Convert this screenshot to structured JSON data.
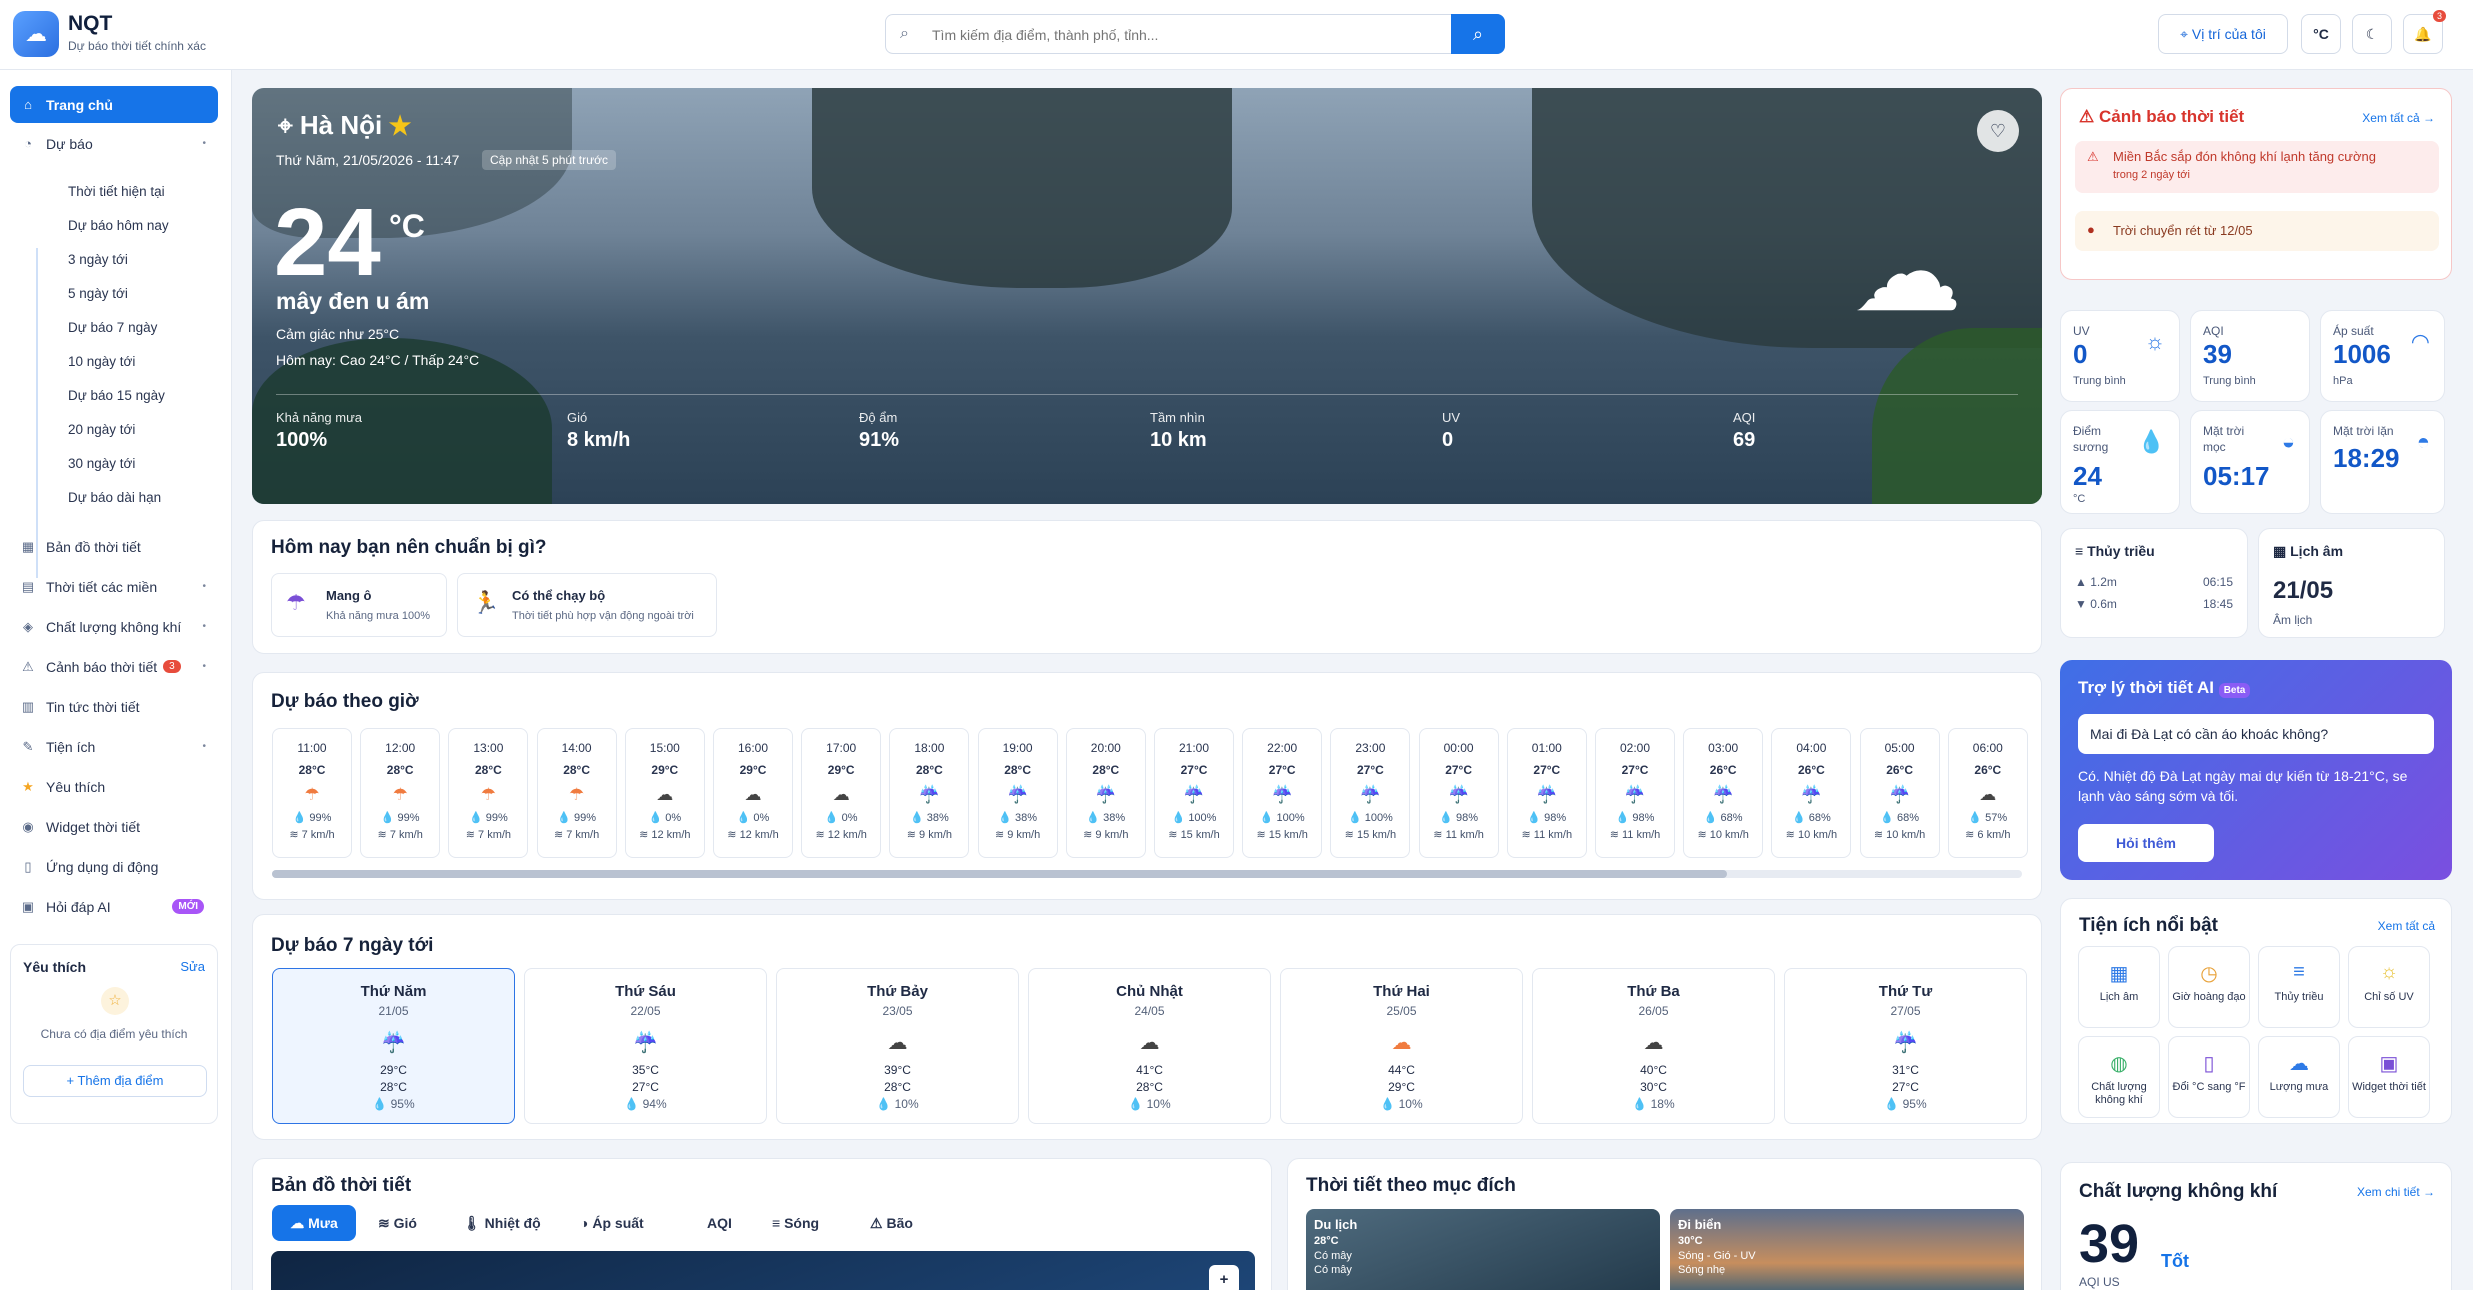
{
  "header": {
    "brand": "NQT",
    "tagline": "Dự báo thời tiết chính xác",
    "search_placeholder": "Tìm kiếm địa điểm, thành phố, tỉnh...",
    "location_btn": "Vị trí của tôi",
    "unit_btn": "°C",
    "notif_count": "3"
  },
  "sidebar": {
    "items": [
      {
        "label": "Trang chủ",
        "icon": "home-icon"
      },
      {
        "label": "Dự báo",
        "icon": "forecast-icon"
      },
      {
        "label": "Bản đồ thời tiết",
        "icon": "map-icon"
      },
      {
        "label": "Thời tiết các miền",
        "icon": "region-icon"
      },
      {
        "label": "Chất lượng không khí",
        "icon": "air-icon"
      },
      {
        "label": "Cảnh báo thời tiết",
        "icon": "alert-icon",
        "badge": "3"
      },
      {
        "label": "Tin tức thời tiết",
        "icon": "news-icon"
      },
      {
        "label": "Tiện ích",
        "icon": "tools-icon"
      },
      {
        "label": "Yêu thích",
        "icon": "star-icon"
      },
      {
        "label": "Widget thời tiết",
        "icon": "widget-icon"
      },
      {
        "label": "Ứng dụng di động",
        "icon": "phone-icon"
      },
      {
        "label": "Hỏi đáp AI",
        "icon": "ai-icon",
        "badge": "MỚI"
      }
    ],
    "sub": [
      "Thời tiết hiện tại",
      "Dự báo hôm nay",
      "3 ngày tới",
      "5 ngày tới",
      "Dự báo 7 ngày",
      "10 ngày tới",
      "Dự báo 15 ngày",
      "20 ngày tới",
      "30 ngày tới",
      "Dự báo dài hạn"
    ],
    "fav": {
      "title": "Yêu thích",
      "edit": "Sửa",
      "empty": "Chưa có địa điểm yêu thích",
      "add": "+ Thêm địa điểm"
    }
  },
  "hero": {
    "city": "Hà Nội",
    "datetime": "Thứ Năm, 21/05/2026 - 11:47",
    "updated": "Cập nhật 5 phút trước",
    "temp": "24",
    "unit": "°C",
    "desc": "mây đen u ám",
    "feels": "Cảm giác như 25°C",
    "today": "Hôm nay: Cao 24°C / Thấp 24°C",
    "stats": [
      {
        "label": "Khả năng mưa",
        "value": "100%"
      },
      {
        "label": "Gió",
        "value": "8 km/h"
      },
      {
        "label": "Độ ẩm",
        "value": "91%"
      },
      {
        "label": "Tầm nhìn",
        "value": "10 km"
      },
      {
        "label": "UV",
        "value": "0"
      },
      {
        "label": "AQI",
        "value": "69"
      }
    ]
  },
  "prep": {
    "title": "Hôm nay bạn nên chuẩn bị gì?",
    "items": [
      {
        "title": "Mang ô",
        "sub": "Khả năng mưa 100%"
      },
      {
        "title": "Có thể chạy bộ",
        "sub": "Thời tiết phù hợp vận động ngoài trời"
      }
    ]
  },
  "hourly": {
    "title": "Dự báo theo giờ",
    "items": [
      {
        "t": "11:00",
        "tp": "28°C",
        "r": "99%",
        "w": "7 km/h",
        "i": "sun-rain"
      },
      {
        "t": "12:00",
        "tp": "28°C",
        "r": "99%",
        "w": "7 km/h",
        "i": "sun-rain"
      },
      {
        "t": "13:00",
        "tp": "28°C",
        "r": "99%",
        "w": "7 km/h",
        "i": "sun-rain"
      },
      {
        "t": "14:00",
        "tp": "28°C",
        "r": "99%",
        "w": "7 km/h",
        "i": "sun-rain"
      },
      {
        "t": "15:00",
        "tp": "29°C",
        "r": "0%",
        "w": "12 km/h",
        "i": "cloud"
      },
      {
        "t": "16:00",
        "tp": "29°C",
        "r": "0%",
        "w": "12 km/h",
        "i": "cloud"
      },
      {
        "t": "17:00",
        "tp": "29°C",
        "r": "0%",
        "w": "12 km/h",
        "i": "cloud"
      },
      {
        "t": "18:00",
        "tp": "28°C",
        "r": "38%",
        "w": "9 km/h",
        "i": "rain"
      },
      {
        "t": "19:00",
        "tp": "28°C",
        "r": "38%",
        "w": "9 km/h",
        "i": "rain"
      },
      {
        "t": "20:00",
        "tp": "28°C",
        "r": "38%",
        "w": "9 km/h",
        "i": "rain"
      },
      {
        "t": "21:00",
        "tp": "27°C",
        "r": "100%",
        "w": "15 km/h",
        "i": "rain"
      },
      {
        "t": "22:00",
        "tp": "27°C",
        "r": "100%",
        "w": "15 km/h",
        "i": "rain"
      },
      {
        "t": "23:00",
        "tp": "27°C",
        "r": "100%",
        "w": "15 km/h",
        "i": "rain"
      },
      {
        "t": "00:00",
        "tp": "27°C",
        "r": "98%",
        "w": "11 km/h",
        "i": "rain"
      },
      {
        "t": "01:00",
        "tp": "27°C",
        "r": "98%",
        "w": "11 km/h",
        "i": "rain"
      },
      {
        "t": "02:00",
        "tp": "27°C",
        "r": "98%",
        "w": "11 km/h",
        "i": "rain"
      },
      {
        "t": "03:00",
        "tp": "26°C",
        "r": "68%",
        "w": "10 km/h",
        "i": "rain"
      },
      {
        "t": "04:00",
        "tp": "26°C",
        "r": "68%",
        "w": "10 km/h",
        "i": "rain"
      },
      {
        "t": "05:00",
        "tp": "26°C",
        "r": "68%",
        "w": "10 km/h",
        "i": "rain"
      },
      {
        "t": "06:00",
        "tp": "26°C",
        "r": "57%",
        "w": "6 km/h",
        "i": "cloud"
      }
    ]
  },
  "daily": {
    "title": "Dự báo 7 ngày tới",
    "items": [
      {
        "d": "Thứ Năm",
        "dt": "21/05",
        "hi": "29°C",
        "lo": "28°C",
        "r": "95%",
        "i": "rain"
      },
      {
        "d": "Thứ Sáu",
        "dt": "22/05",
        "hi": "35°C",
        "lo": "27°C",
        "r": "94%",
        "i": "rain"
      },
      {
        "d": "Thứ Bảy",
        "dt": "23/05",
        "hi": "39°C",
        "lo": "28°C",
        "r": "10%",
        "i": "cloud"
      },
      {
        "d": "Chủ Nhật",
        "dt": "24/05",
        "hi": "41°C",
        "lo": "28°C",
        "r": "10%",
        "i": "cloud"
      },
      {
        "d": "Thứ Hai",
        "dt": "25/05",
        "hi": "44°C",
        "lo": "29°C",
        "r": "10%",
        "i": "sun-cloud"
      },
      {
        "d": "Thứ Ba",
        "dt": "26/05",
        "hi": "40°C",
        "lo": "30°C",
        "r": "18%",
        "i": "cloud"
      },
      {
        "d": "Thứ Tư",
        "dt": "27/05",
        "hi": "31°C",
        "lo": "27°C",
        "r": "95%",
        "i": "rain"
      }
    ]
  },
  "map": {
    "title": "Bản đồ thời tiết",
    "tabs": [
      "Mưa",
      "Gió",
      "Nhiệt độ",
      "Áp suất",
      "AQI",
      "Sóng",
      "Bão"
    ]
  },
  "purpose": {
    "title": "Thời tiết theo mục đích",
    "items": [
      {
        "name": "Du lịch",
        "temp": "28°C",
        "l1": "Có mây",
        "l2": "Có mây"
      },
      {
        "name": "Đi biển",
        "temp": "30°C",
        "l1": "Sóng - Gió - UV",
        "l2": "Sóng nhẹ"
      }
    ]
  },
  "alerts": {
    "title": "Cảnh báo thời tiết",
    "more": "Xem tất cả →",
    "items": [
      "Miền Bắc sắp đón không khí lạnh tăng cường",
      "Trời chuyển rét từ 12/05"
    ],
    "sub": "trong 2 ngày tới"
  },
  "metrics": [
    {
      "label": "UV",
      "value": "0",
      "sub": "Trung bình",
      "icon": "sun-icon"
    },
    {
      "label": "AQI",
      "value": "39",
      "sub": "Trung bình",
      "icon": "aqi-icon"
    },
    {
      "label": "Áp suất",
      "value": "1006",
      "sub": "hPa",
      "icon": "gauge-icon"
    },
    {
      "label": "Điểm sương",
      "value": "24",
      "sub": "°C",
      "icon": "drop-icon"
    },
    {
      "label": "Mặt trời mọc",
      "value": "05:17",
      "sub": "",
      "icon": "sunrise-icon"
    },
    {
      "label": "Mặt trời lặn",
      "value": "18:29",
      "sub": "",
      "icon": "sunset-icon"
    }
  ],
  "tide": {
    "title": "Thủy triều",
    "hi": "1.2m",
    "hit": "06:15",
    "lo": "0.6m",
    "lot": "18:45"
  },
  "lunar": {
    "title": "Lịch âm",
    "date": "21/05",
    "sub": "Âm lịch"
  },
  "ai": {
    "title": "Trợ lý thời tiết AI",
    "beta": "Beta",
    "question": "Mai đi Đà Lạt có cần áo khoác không?",
    "answer": "Có. Nhiệt độ Đà Lạt ngày mai dự kiến từ 18-21°C, se lạnh vào sáng sớm và tối.",
    "btn": "Hỏi thêm"
  },
  "tools": {
    "title": "Tiện ích nổi bật",
    "more": "Xem tất cả",
    "items": [
      "Lịch âm",
      "Giờ hoàng đạo",
      "Thủy triều",
      "Chỉ số UV",
      "Chất lượng không khí",
      "Đổi °C sang °F",
      "Lượng mưa",
      "Widget thời tiết"
    ]
  },
  "aq": {
    "title": "Chất lượng không khí",
    "more": "Xem chi tiết →",
    "value": "39",
    "label": "Tốt",
    "sub": "AQI US"
  }
}
